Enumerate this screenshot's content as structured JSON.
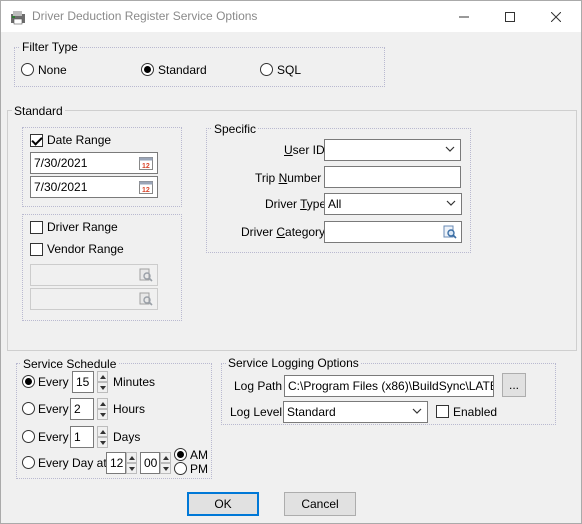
{
  "window": {
    "title": "Driver Deduction Register Service Options",
    "minimize_icon": "minimize-icon",
    "maximize_icon": "maximize-icon",
    "close_icon": "close-icon"
  },
  "filter_type": {
    "legend": "Filter Type",
    "options": [
      "None",
      "Standard",
      "SQL"
    ],
    "selected": "Standard"
  },
  "standard": {
    "legend": "Standard",
    "date_range": {
      "label": "Date Range",
      "checked": true,
      "from": "7/30/2021",
      "to": "7/30/2021"
    },
    "driver_range": {
      "label": "Driver Range",
      "checked": false
    },
    "vendor_range": {
      "label": "Vendor Range",
      "checked": false,
      "from": "",
      "to": ""
    },
    "specific": {
      "legend": "Specific",
      "user_id": {
        "label_pre": "",
        "label_ul": "U",
        "label_post": "ser ID",
        "value": ""
      },
      "trip_number": {
        "label_pre": "Trip ",
        "label_ul": "N",
        "label_post": "umber",
        "value": ""
      },
      "driver_type": {
        "label_pre": "Driver ",
        "label_ul": "T",
        "label_post": "ype",
        "value": "All"
      },
      "driver_category": {
        "label_pre": "Driver ",
        "label_ul": "C",
        "label_post": "ategory",
        "value": ""
      }
    }
  },
  "service_schedule": {
    "legend": "Service Schedule",
    "every_minutes": {
      "label": "Every",
      "value": "15",
      "unit": "Minutes",
      "selected": true
    },
    "every_hours": {
      "label": "Every",
      "value": "2",
      "unit": "Hours",
      "selected": false
    },
    "every_days": {
      "label": "Every",
      "value": "1",
      "unit": "Days",
      "selected": false
    },
    "every_day_at": {
      "label": "Every Day at",
      "hour": "12",
      "minute": "00",
      "am": "AM",
      "pm": "PM",
      "ampm_selected": "AM",
      "selected": false
    }
  },
  "logging": {
    "legend": "Service Logging Options",
    "log_path_label": "Log Path",
    "log_path_value": "C:\\Program Files (x86)\\BuildSync\\LATE",
    "browse_label": "...",
    "log_level_label": "Log Level",
    "log_level_value": "Standard",
    "enabled_label": "Enabled",
    "enabled_checked": false
  },
  "buttons": {
    "ok": "OK",
    "cancel": "Cancel"
  },
  "colors": {
    "accent": "#0078d7",
    "calendar_icon": "#d9452b",
    "lookup_icon": "#3a6ea5"
  }
}
